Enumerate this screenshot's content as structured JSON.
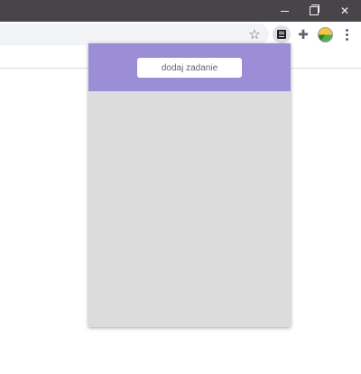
{
  "window_controls": {
    "minimize_icon": "minimize-icon",
    "maximize_icon": "restore-icon",
    "close_icon": "close-icon",
    "close_glyph": "✕"
  },
  "toolbar": {
    "bookmark_icon": "star-icon",
    "bookmark_glyph": "☆",
    "active_extension_icon": "list-icon",
    "extensions_icon": "puzzle-icon",
    "extensions_glyph": "✚",
    "profile_icon": "avatar-icon",
    "menu_icon": "kebab-menu-icon"
  },
  "popup": {
    "header_color": "#9b8ed7",
    "body_color": "#dcdcdc",
    "add_task_label": "dodaj zadanie"
  },
  "colors": {
    "titlebar": "#48454a",
    "omnibox": "#f1f3f4",
    "page": "#ffffff"
  }
}
